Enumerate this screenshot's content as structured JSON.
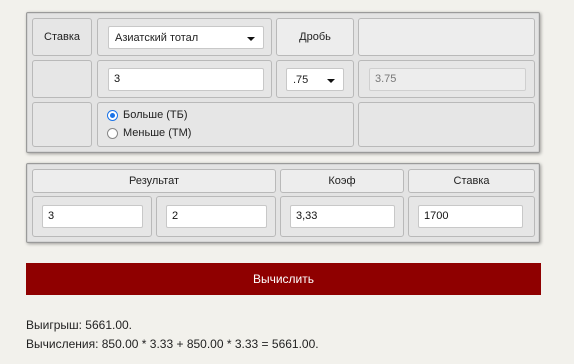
{
  "top_panel": {
    "bet_label": "Ставка",
    "bet_type_value": "Азиатский тотал",
    "fraction_label": "Дробь",
    "total_input_value": "3",
    "fraction_value": ".75",
    "combined_value": "3.75",
    "option_over": "Больше (ТБ)",
    "option_under": "Меньше (ТМ)",
    "selected_option": "over"
  },
  "bottom_panel": {
    "headers": {
      "result": "Результат",
      "coef": "Коэф",
      "stake": "Ставка"
    },
    "values": {
      "result_home": "3",
      "result_away": "2",
      "coef": "3,33",
      "stake": "1700"
    }
  },
  "calculate_button": "Вычислить",
  "output": {
    "winnings": "Выигрыш: 5661.00.",
    "calculation": "Вычисления: 850.00 * 3.33 + 850.00 * 3.33 = 5661.00."
  },
  "colors": {
    "button_bg": "#8f0000",
    "page_bg": "#f2f1ec",
    "radio_accent": "#1a73e8"
  }
}
